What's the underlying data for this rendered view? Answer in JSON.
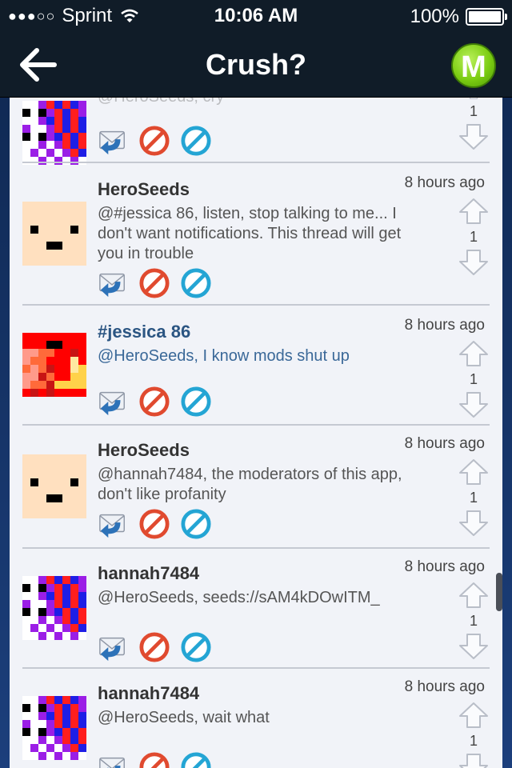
{
  "status_bar": {
    "signal": "●●●○○",
    "carrier": "Sprint",
    "time": "10:06 AM",
    "battery": "100%",
    "battery_level": 1.0
  },
  "nav": {
    "title": "Crush?",
    "badge": "M",
    "back_icon": "back-arrow-icon"
  },
  "colors": {
    "username_highlight": "#2b5582",
    "reply_icon_blue": "#2d72b8",
    "block_red": "#e04a2f",
    "ignore_cyan": "#24a5d4",
    "badge_green": "#7ccd12"
  },
  "posts": [
    {
      "username": "",
      "time": "",
      "message": "@HeroSeeds, cry",
      "votes": "1",
      "avatar": "magenta-checker"
    },
    {
      "username": "HeroSeeds",
      "time": "8 hours ago",
      "message": "@#jessica 86, listen, stop talking to me... I don't want notifications. This thread will get you in trouble",
      "votes": "1",
      "avatar": "peach-face"
    },
    {
      "username": "#jessica 86",
      "time": "8 hours ago",
      "message": "@HeroSeeds, I know mods shut up",
      "votes": "1",
      "avatar": "red-fire"
    },
    {
      "username": "HeroSeeds",
      "time": "8 hours ago",
      "message": "@hannah7484, the moderators of this app, don't like profanity",
      "votes": "1",
      "avatar": "peach-face"
    },
    {
      "username": "hannah7484",
      "time": "8 hours ago",
      "message": "@HeroSeeds, seeds://sAM4kDOwITM_",
      "votes": "1",
      "avatar": "magenta-checker"
    },
    {
      "username": "hannah7484",
      "time": "8 hours ago",
      "message": "@HeroSeeds, wait what",
      "votes": "1",
      "avatar": "magenta-checker"
    }
  ]
}
